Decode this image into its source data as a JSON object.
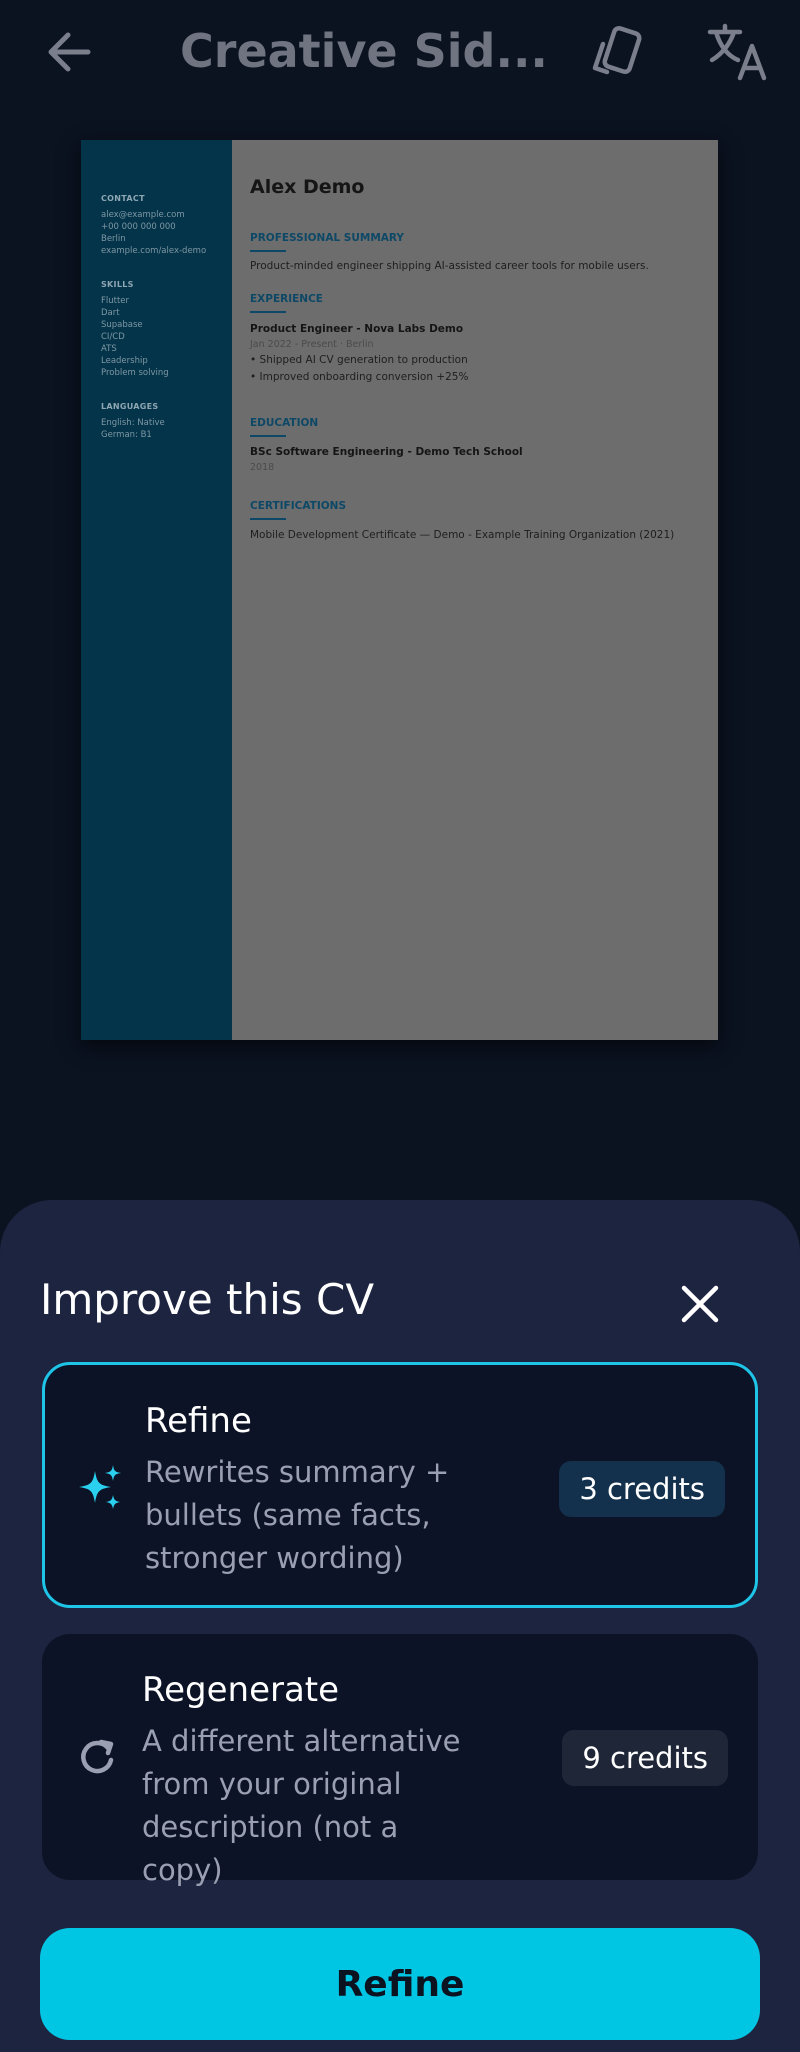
{
  "app_bar": {
    "title": "Creative Sid...",
    "back_icon": "arrow-left-icon",
    "template_icon": "template-cards-icon",
    "translate_icon": "translate-icon"
  },
  "cv": {
    "name": "Alex Demo",
    "sidebar": {
      "contact_heading": "CONTACT",
      "contact": [
        "alex@example.com",
        "+00 000 000 000",
        "Berlin",
        "example.com/alex-demo"
      ],
      "skills_heading": "SKILLS",
      "skills": [
        "Flutter",
        "Dart",
        "Supabase",
        "CI/CD",
        "ATS",
        "Leadership",
        "Problem solving"
      ],
      "languages_heading": "LANGUAGES",
      "languages": [
        "English: Native",
        "German: B1"
      ]
    },
    "summary_heading": "PROFESSIONAL SUMMARY",
    "summary": "Product-minded engineer shipping AI-assisted career tools for mobile users.",
    "experience_heading": "EXPERIENCE",
    "experience": {
      "role": "Product Engineer - Nova Labs Demo",
      "meta": "Jan 2022 - Present · Berlin",
      "bullets": [
        "• Shipped AI CV generation to production",
        "• Improved onboarding conversion +25%"
      ]
    },
    "education_heading": "EDUCATION",
    "education": {
      "degree": "BSc Software Engineering - Demo Tech School",
      "year": "2018"
    },
    "certifications_heading": "CERTIFICATIONS",
    "certification": "Mobile Development Certificate — Demo - Example Training Organization (2021)"
  },
  "sheet": {
    "title": "Improve this CV",
    "close_icon": "close-icon",
    "options": [
      {
        "name": "Refine",
        "description": "Rewrites summary + bullets (same facts, stronger wording)",
        "credits": "3 credits",
        "icon": "sparkles-icon",
        "selected": true
      },
      {
        "name": "Regenerate",
        "description": "A different alternative from your original description (not a copy)",
        "credits": "9 credits",
        "icon": "refresh-icon",
        "selected": false
      }
    ],
    "cta_label": "Refine"
  },
  "colors": {
    "background": "#0b1220",
    "sheet": "#1d2440",
    "accent": "#00c5e3",
    "cv_sidebar": "#033449"
  }
}
